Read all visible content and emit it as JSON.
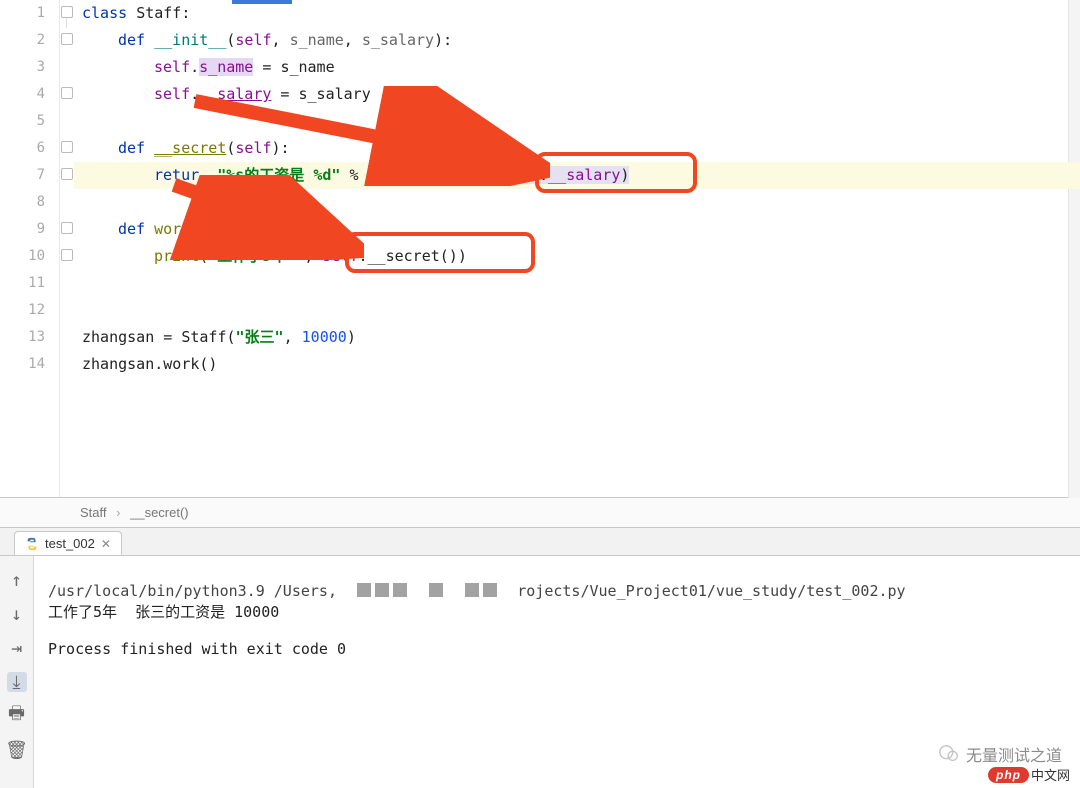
{
  "editor": {
    "lines": [
      "1",
      "2",
      "3",
      "4",
      "5",
      "6",
      "7",
      "8",
      "9",
      "10",
      "11",
      "12",
      "13",
      "14"
    ],
    "code": {
      "l1": {
        "kw_class": "class",
        "cls": "Staff",
        "colon": ":"
      },
      "l2": {
        "kw_def": "def",
        "fn": "__init__",
        "lp": "(",
        "p1": "self",
        "c1": ", ",
        "p2": "s_name",
        "c2": ", ",
        "p3": "s_salary",
        "rp": "):"
      },
      "l3": {
        "self": "self",
        "dot": ".",
        "attr": "s_name",
        "eq": " = ",
        "rhs": "s_name"
      },
      "l4": {
        "self": "self",
        "dot": ".",
        "attr": "__salary",
        "eq": " = ",
        "rhs": "s_salary"
      },
      "l6": {
        "kw_def": "def",
        "fn": "__secret",
        "lp": "(",
        "p1": "self",
        "rp": "):"
      },
      "l7": {
        "kw_return": "retur",
        "str": "\"%s的工资是 %d\"",
        "pct": " % (",
        "self1": "self",
        "dot1": ".",
        "attr1": "s_name",
        "comma": ", ",
        "self2": "self",
        "dot2": ".",
        "attr2": "__salary",
        "close": ")"
      },
      "l9": {
        "kw_def": "def",
        "fn": "work",
        "lp": "(",
        "p1": "self",
        "rp": "):"
      },
      "l10": {
        "fn": "print",
        "lp": "(",
        "str": "\"工作了5年 \"",
        "comma": ", ",
        "self": "self",
        "dot": ".",
        "call": "__secret()",
        "rp": ")"
      },
      "l13": {
        "var": "zhangsan",
        "eq": " = ",
        "cls": "Staff",
        "lp": "(",
        "str": "\"张三\"",
        "comma": ", ",
        "num": "10000",
        "rp": ")"
      },
      "l14": {
        "var": "zhangsan",
        "dot": ".",
        "call": "work()"
      }
    }
  },
  "breadcrumbs": {
    "a": "Staff",
    "b": "__secret()"
  },
  "tab": {
    "name": "test_002"
  },
  "console": {
    "path_prefix": "/usr/local/bin/python3.9 /Users",
    "path_suffix": "rojects/Vue_Project01/vue_study/test_002.py",
    "out_line": "工作了5年  张三的工资是 10000",
    "exit_line": "Process finished with exit code 0"
  },
  "watermark": "无量测试之道",
  "php_badge": {
    "logo": "php",
    "text": "中文网"
  }
}
